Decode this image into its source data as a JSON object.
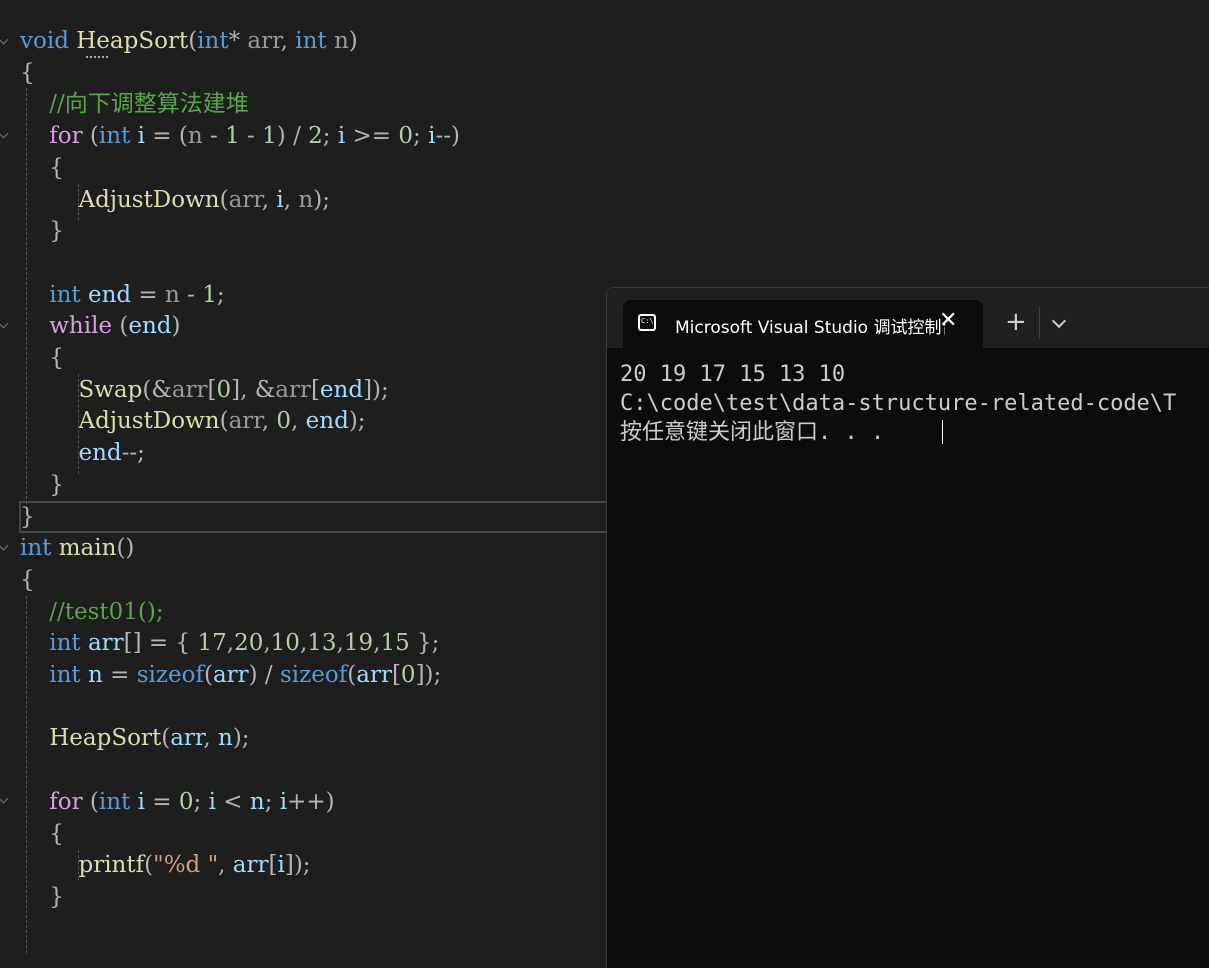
{
  "editor": {
    "code": [
      [
        [
          "kw",
          "void "
        ],
        [
          "fn",
          "HeapSort"
        ],
        [
          "pun",
          "("
        ],
        [
          "kw",
          "int"
        ],
        [
          "pun",
          "* "
        ],
        [
          "prm",
          "arr"
        ],
        [
          "pun",
          ", "
        ],
        [
          "kw",
          "int "
        ],
        [
          "prm",
          "n"
        ],
        [
          "pun",
          ")"
        ]
      ],
      [
        [
          "pun",
          "{"
        ]
      ],
      [
        [
          "cmt",
          "    //向下调整算法建堆"
        ]
      ],
      [
        [
          "ctl",
          "    for "
        ],
        [
          "pun",
          "("
        ],
        [
          "kw",
          "int "
        ],
        [
          "var",
          "i"
        ],
        [
          "pun",
          " = ("
        ],
        [
          "prm",
          "n"
        ],
        [
          "pun",
          " - "
        ],
        [
          "num",
          "1"
        ],
        [
          "pun",
          " - "
        ],
        [
          "num",
          "1"
        ],
        [
          "pun",
          ") / "
        ],
        [
          "num",
          "2"
        ],
        [
          "pun",
          "; "
        ],
        [
          "var",
          "i"
        ],
        [
          "pun",
          " >= "
        ],
        [
          "num",
          "0"
        ],
        [
          "pun",
          "; "
        ],
        [
          "var",
          "i"
        ],
        [
          "pun",
          "--)"
        ]
      ],
      [
        [
          "pun",
          "    {"
        ]
      ],
      [
        [
          "fn",
          "        AdjustDown"
        ],
        [
          "pun",
          "("
        ],
        [
          "prm",
          "arr"
        ],
        [
          "pun",
          ", "
        ],
        [
          "var",
          "i"
        ],
        [
          "pun",
          ", "
        ],
        [
          "prm",
          "n"
        ],
        [
          "pun",
          ");"
        ]
      ],
      [
        [
          "pun",
          "    }"
        ]
      ],
      [],
      [
        [
          "kw",
          "    int "
        ],
        [
          "var",
          "end"
        ],
        [
          "pun",
          " = "
        ],
        [
          "prm",
          "n"
        ],
        [
          "pun",
          " - "
        ],
        [
          "num",
          "1"
        ],
        [
          "pun",
          ";"
        ]
      ],
      [
        [
          "ctl",
          "    while "
        ],
        [
          "pun",
          "("
        ],
        [
          "var",
          "end"
        ],
        [
          "pun",
          ")"
        ]
      ],
      [
        [
          "pun",
          "    {"
        ]
      ],
      [
        [
          "fn",
          "        Swap"
        ],
        [
          "pun",
          "(&"
        ],
        [
          "prm",
          "arr"
        ],
        [
          "pun",
          "["
        ],
        [
          "num",
          "0"
        ],
        [
          "pun",
          "], &"
        ],
        [
          "prm",
          "arr"
        ],
        [
          "pun",
          "["
        ],
        [
          "var",
          "end"
        ],
        [
          "pun",
          "]);"
        ]
      ],
      [
        [
          "fn",
          "        AdjustDown"
        ],
        [
          "pun",
          "("
        ],
        [
          "prm",
          "arr"
        ],
        [
          "pun",
          ", "
        ],
        [
          "num",
          "0"
        ],
        [
          "pun",
          ", "
        ],
        [
          "var",
          "end"
        ],
        [
          "pun",
          ");"
        ]
      ],
      [
        [
          "var",
          "        end"
        ],
        [
          "pun",
          "--;"
        ]
      ],
      [
        [
          "pun",
          "    }"
        ]
      ],
      [
        [
          "pun",
          "}"
        ]
      ],
      [
        [
          "kw",
          "int "
        ],
        [
          "fn",
          "main"
        ],
        [
          "pun",
          "()"
        ]
      ],
      [
        [
          "pun",
          "{"
        ]
      ],
      [
        [
          "cmt",
          "    //test01();"
        ]
      ],
      [
        [
          "kw",
          "    int "
        ],
        [
          "var",
          "arr"
        ],
        [
          "pun",
          "[] = { "
        ],
        [
          "num",
          "17"
        ],
        [
          "pun",
          ","
        ],
        [
          "num",
          "20"
        ],
        [
          "pun",
          ","
        ],
        [
          "num",
          "10"
        ],
        [
          "pun",
          ","
        ],
        [
          "num",
          "13"
        ],
        [
          "pun",
          ","
        ],
        [
          "num",
          "19"
        ],
        [
          "pun",
          ","
        ],
        [
          "num",
          "15"
        ],
        [
          "pun",
          " };"
        ]
      ],
      [
        [
          "kw",
          "    int "
        ],
        [
          "var",
          "n"
        ],
        [
          "pun",
          " = "
        ],
        [
          "kw",
          "sizeof"
        ],
        [
          "pun",
          "("
        ],
        [
          "var",
          "arr"
        ],
        [
          "pun",
          ") / "
        ],
        [
          "kw",
          "sizeof"
        ],
        [
          "pun",
          "("
        ],
        [
          "var",
          "arr"
        ],
        [
          "pun",
          "["
        ],
        [
          "num",
          "0"
        ],
        [
          "pun",
          "]);"
        ]
      ],
      [],
      [
        [
          "fn",
          "    HeapSort"
        ],
        [
          "pun",
          "("
        ],
        [
          "var",
          "arr"
        ],
        [
          "pun",
          ", "
        ],
        [
          "var",
          "n"
        ],
        [
          "pun",
          ");"
        ]
      ],
      [],
      [
        [
          "ctl",
          "    for "
        ],
        [
          "pun",
          "("
        ],
        [
          "kw",
          "int "
        ],
        [
          "var",
          "i"
        ],
        [
          "pun",
          " = "
        ],
        [
          "num",
          "0"
        ],
        [
          "pun",
          "; "
        ],
        [
          "var",
          "i"
        ],
        [
          "pun",
          " < "
        ],
        [
          "var",
          "n"
        ],
        [
          "pun",
          "; "
        ],
        [
          "var",
          "i"
        ],
        [
          "pun",
          "++)"
        ]
      ],
      [
        [
          "pun",
          "    {"
        ]
      ],
      [
        [
          "fn",
          "        printf"
        ],
        [
          "pun",
          "("
        ],
        [
          "str",
          "\"%d \""
        ],
        [
          "pun",
          ", "
        ],
        [
          "var",
          "arr"
        ],
        [
          "pun",
          "["
        ],
        [
          "var",
          "i"
        ],
        [
          "pun",
          "]);"
        ]
      ],
      [
        [
          "pun",
          "    }"
        ]
      ]
    ]
  },
  "terminal": {
    "tab_title": "Microsoft Visual Studio 调试控制台",
    "tab_icon_label": "C:\\",
    "close_glyph": "✕",
    "new_tab_glyph": "+",
    "output": [
      "20 19 17 15 13 10",
      "C:\\code\\test\\data-structure-related-code\\T",
      "按任意键关闭此窗口. . ."
    ]
  }
}
